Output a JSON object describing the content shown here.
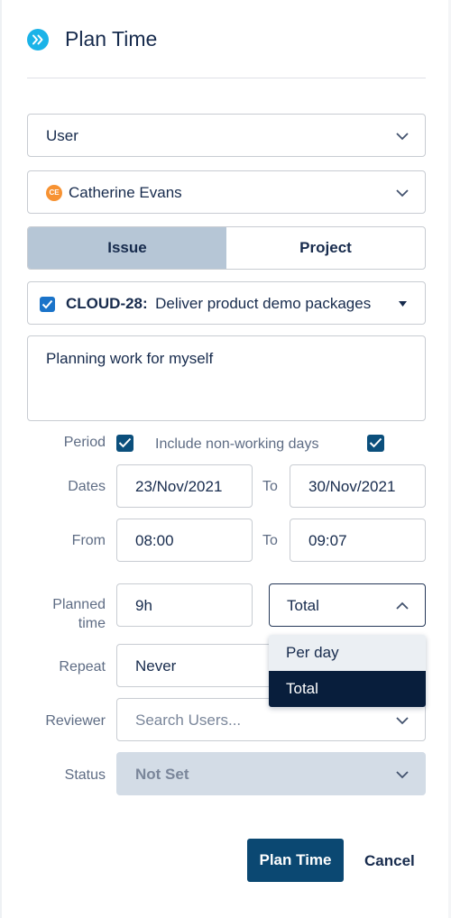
{
  "panel": {
    "title": "Plan Time",
    "expand_icon": "double-chevron-right-icon",
    "accent": "#1bb3e8"
  },
  "assignee_type": {
    "value": "User"
  },
  "assignee": {
    "initials": "CE",
    "name": "Catherine Evans",
    "avatar_color": "#f79232"
  },
  "scope_toggle": {
    "issue_label": "Issue",
    "project_label": "Project",
    "selected": "Issue"
  },
  "issue": {
    "key": "CLOUD-28:",
    "summary": "Deliver product demo packages",
    "checked": true
  },
  "description": {
    "value": "Planning work for myself"
  },
  "period": {
    "label": "Period",
    "checked": true,
    "non_working_label": "Include non-working days",
    "non_working_checked": true
  },
  "dates": {
    "label": "Dates",
    "start": "23/Nov/2021",
    "to_label": "To",
    "end": "30/Nov/2021"
  },
  "time": {
    "label": "From",
    "start": "08:00",
    "to_label": "To",
    "end": "09:07"
  },
  "planned_time": {
    "label_line1": "Planned",
    "label_line2": "time",
    "value": "9h",
    "mode": "Total",
    "options": [
      "Per day",
      "Total"
    ],
    "selected_option": "Total"
  },
  "repeat": {
    "label": "Repeat",
    "value": "Never"
  },
  "reviewer": {
    "label": "Reviewer",
    "placeholder": "Search Users..."
  },
  "status": {
    "label": "Status",
    "value": "Not Set"
  },
  "actions": {
    "submit_label": "Plan Time",
    "cancel_label": "Cancel",
    "primary_color": "#0b4872"
  }
}
